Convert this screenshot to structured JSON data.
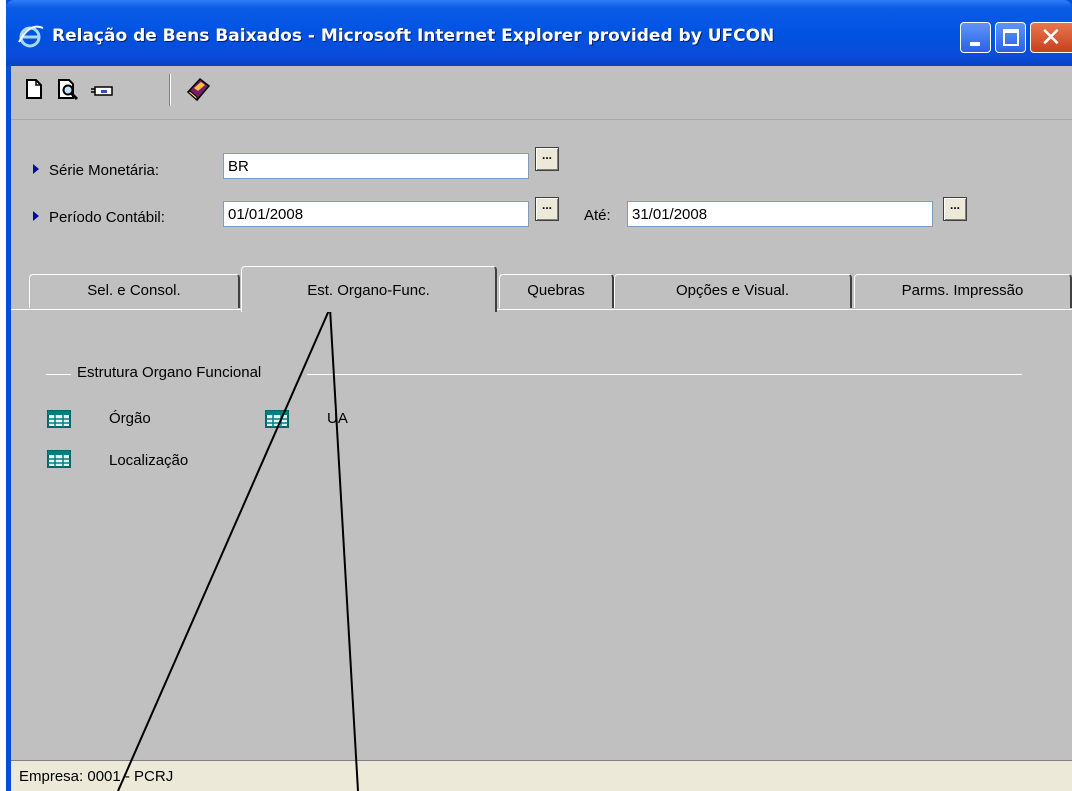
{
  "window": {
    "title": "Relação de Bens Baixados - Microsoft Internet Explorer provided by UFCON",
    "buttons": {
      "minimize": "minimize",
      "maximize": "maximize",
      "close": "close"
    }
  },
  "toolbar": {
    "icons": [
      "new-document-icon",
      "print-preview-icon",
      "print-icon",
      "help-book-icon"
    ]
  },
  "form": {
    "serie_label": "Série Monetária:",
    "serie_value": "BR",
    "periodo_label": "Período Contábil:",
    "periodo_start": "01/01/2008",
    "ate_label": "Até:",
    "periodo_end": "31/01/2008",
    "ellipsis": "..."
  },
  "tabs": [
    {
      "label": "Sel. e Consol.",
      "active": false
    },
    {
      "label": "Est. Organo-Func.",
      "active": true
    },
    {
      "label": "Quebras",
      "active": false
    },
    {
      "label": "Opções e Visual.",
      "active": false
    },
    {
      "label": "Parms. Impressão",
      "active": false
    }
  ],
  "group": {
    "title": "Estrutura Organo Funcional",
    "items": [
      {
        "label": "Órgão",
        "icon": "table-grid-icon"
      },
      {
        "label": "UA",
        "icon": "table-grid-icon"
      },
      {
        "label": "Localização",
        "icon": "table-grid-icon"
      }
    ]
  },
  "status": {
    "text": "Empresa: 0001 - PCRJ"
  },
  "colors": {
    "title_bar": "#0053e2",
    "client_bg": "#c0c0c0",
    "status_bg": "#ece9d8"
  }
}
